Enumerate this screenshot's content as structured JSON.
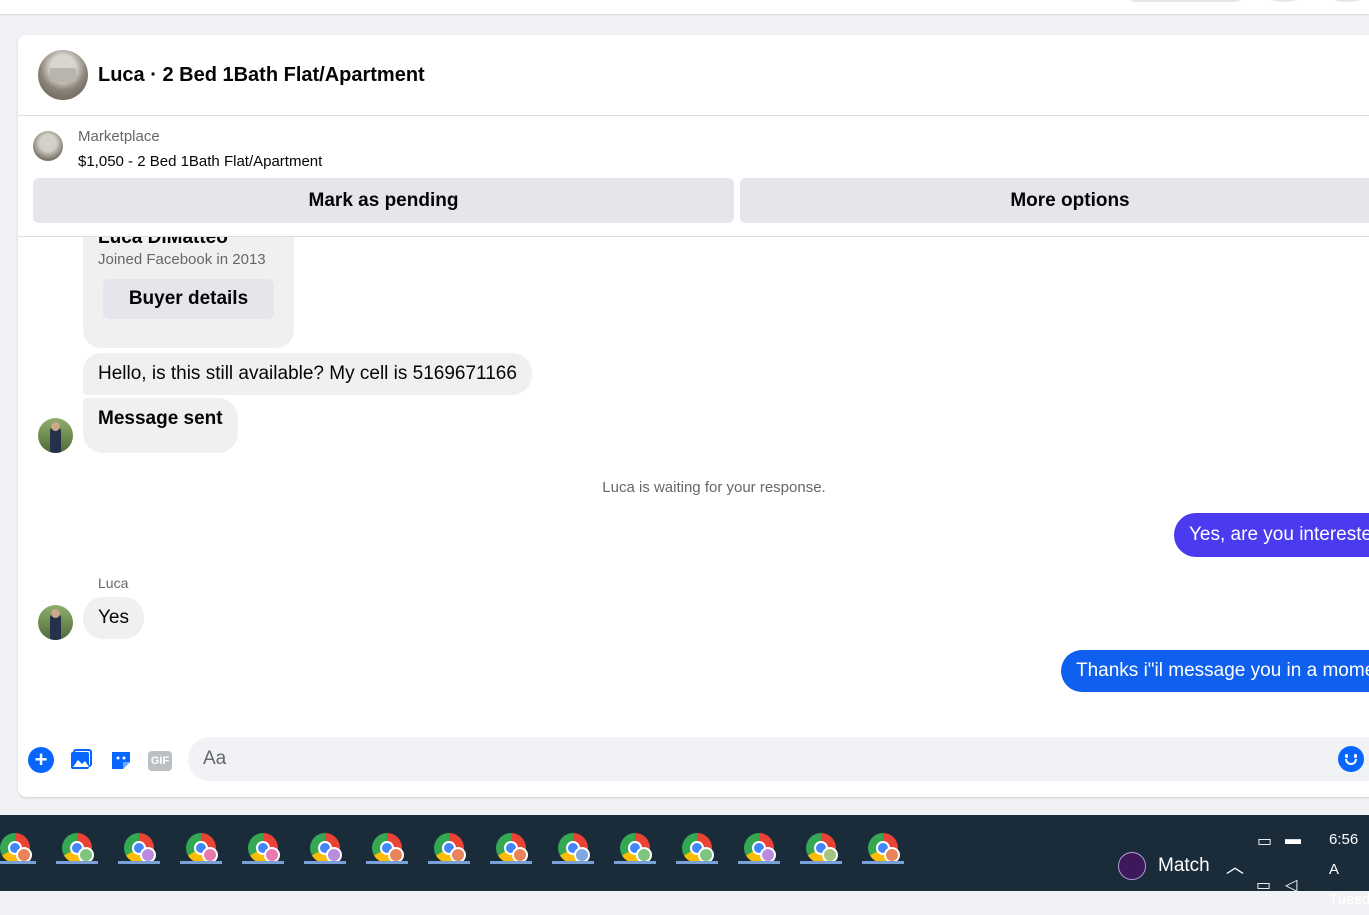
{
  "header": {
    "title": "Luca · 2 Bed 1Bath Flat/Apartment"
  },
  "listing": {
    "label": "Marketplace",
    "price_title": "$1,050 - 2 Bed 1Bath Flat/Apartment",
    "mark_pending_label": "Mark as pending",
    "more_options_label": "More options"
  },
  "profile_card": {
    "name": "Luca DiMatteo",
    "joined": "Joined Facebook in 2013",
    "buyer_details_label": "Buyer details"
  },
  "messages": {
    "incoming_1": "Hello, is this still available? My cell is 5169671166",
    "incoming_2": "Message sent",
    "waiting_notice": "Luca is waiting for your response.",
    "outgoing_1": "Yes, are you interested",
    "sender_name": "Luca",
    "incoming_3": "Yes",
    "outgoing_2": "Thanks i\"il message you in a momen"
  },
  "composer": {
    "placeholder": "Aa",
    "gif_label": "GIF"
  },
  "taskbar": {
    "badge_colors": [
      "#e8845c",
      "#7fc47f",
      "#b98ce0",
      "#e87ab0",
      "#e87ab0",
      "#b98ce0",
      "#e8845c",
      "#e8845c",
      "#e8845c",
      "#7fa7e0",
      "#7fc47f",
      "#7fc47f",
      "#b98ce0",
      "#a5c47f",
      "#e8845c"
    ],
    "match_label": "Match",
    "time": "6:56 A",
    "day": "Tuesd"
  }
}
